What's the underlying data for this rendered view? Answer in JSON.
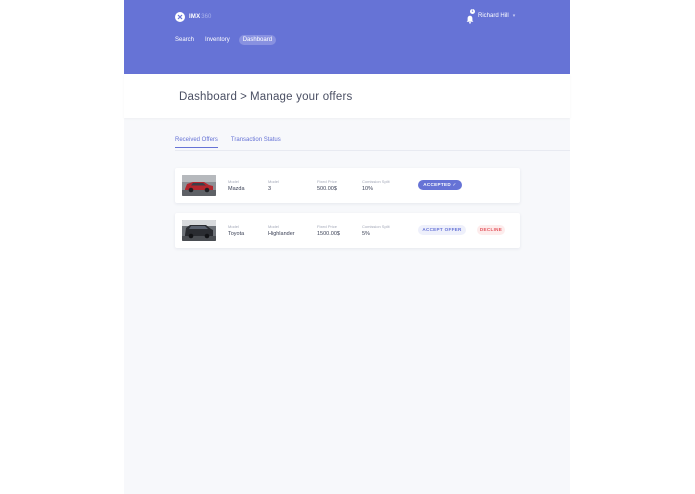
{
  "app": {
    "logo_text": "IMX",
    "logo_sub": "360"
  },
  "nav": {
    "items": [
      {
        "label": "Search"
      },
      {
        "label": "Inventory"
      },
      {
        "label": "Dashboard",
        "active": true
      }
    ]
  },
  "user": {
    "name": "Richard Hill",
    "notification_count": "1"
  },
  "page": {
    "breadcrumb_root": "Dashboard",
    "breadcrumb_sep": ">",
    "breadcrumb_current": "Manage your offers"
  },
  "tabs": [
    {
      "label": "Received Offers",
      "active": true
    },
    {
      "label": "Transaction Status"
    }
  ],
  "offers": [
    {
      "image": "red-sedan-photo",
      "make_label": "Model",
      "make": "Mazda",
      "model_label": "Model",
      "model": "3",
      "price_label": "Fixed Price",
      "price": "500.00$",
      "split_label": "Comission Split",
      "split": "10%",
      "status": "ACCEPTED ✓"
    },
    {
      "image": "dark-suv-photo",
      "make_label": "Model",
      "make": "Toyota",
      "model_label": "Model",
      "model": "Highlander",
      "price_label": "Fixed Price",
      "price": "1500.00$",
      "split_label": "Comission Split",
      "split": "5%",
      "accept_label": "ACCEPT OFFER",
      "decline_label": "DECLINE"
    }
  ],
  "colors": {
    "brand": "#6673d6",
    "background": "#f7f8fb",
    "decline": "#e3545c"
  }
}
